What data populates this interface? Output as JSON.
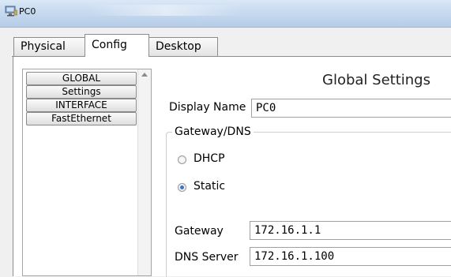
{
  "window": {
    "title": "PC0",
    "icon": "pc-icon"
  },
  "tabs": [
    {
      "label": "Physical",
      "active": false
    },
    {
      "label": "Config",
      "active": true
    },
    {
      "label": "Desktop",
      "active": false
    }
  ],
  "nav": {
    "items": [
      "GLOBAL",
      "Settings",
      "INTERFACE",
      "FastEthernet"
    ]
  },
  "panel": {
    "title": "Global Settings",
    "display_name_label": "Display Name",
    "display_name_value": "PC0",
    "group_title": "Gateway/DNS",
    "dhcp_label": "DHCP",
    "static_label": "Static",
    "selected_mode": "Static",
    "gateway_label": "Gateway",
    "gateway_value": "172.16.1.1",
    "dns_label": "DNS Server",
    "dns_value": "172.16.1.100"
  },
  "colors": {
    "radio_selected": "#3a74c8",
    "titlebar": "#c6d9ef"
  }
}
